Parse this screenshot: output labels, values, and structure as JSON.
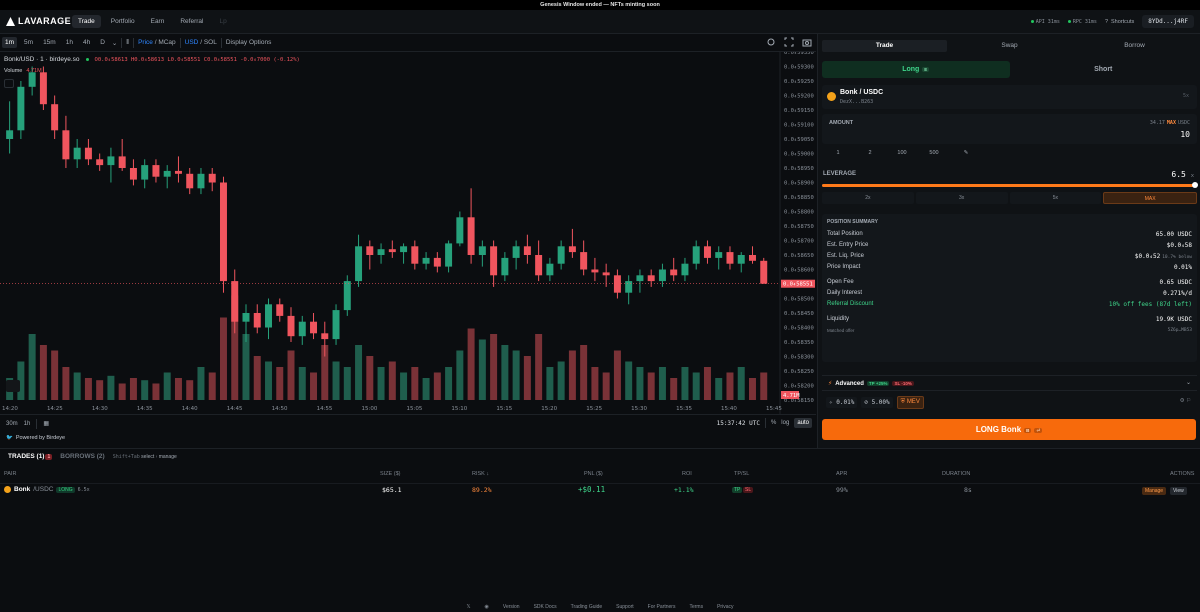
{
  "banner": "Genesis Window ended — NFTs minting soon",
  "brand": "LAVARAGE",
  "nav": [
    "Trade",
    "Portfolio",
    "Earn",
    "Referral",
    "Lp"
  ],
  "status": {
    "api": "API 31ms",
    "rpc": "RPC 31ms"
  },
  "shortcuts": "Shortcuts",
  "wallet": "8YDd...j4RF",
  "toolbar": {
    "timeframes": [
      "1m",
      "5m",
      "15m",
      "1h",
      "4h",
      "D"
    ],
    "price": "Price",
    "mcap": "MCap",
    "usd": "USD",
    "sol": "SOL",
    "display_options": "Display Options"
  },
  "legend": {
    "symbol": "Bonk/USD · 1 · birdeye.so",
    "ohlc": "O0.0₄58613 H0.0₄58613 L0.0₄58551 C0.0₄58551 -0.0₆7000 (-0.12%)",
    "volume_label": "Volume",
    "volume_value": "4.71M"
  },
  "chart_bottom": {
    "ranges": [
      "30m",
      "1h"
    ],
    "time": "15:37:42 UTC",
    "pct": "%",
    "log": "log",
    "auto": "auto"
  },
  "powered": "Powered by Birdeye",
  "chart_data": {
    "type": "candlestick",
    "x_ticks": [
      "14:20",
      "14:25",
      "14:30",
      "14:35",
      "14:40",
      "14:45",
      "14:50",
      "14:55",
      "15:00",
      "15:05",
      "15:10",
      "15:15",
      "15:20",
      "15:25",
      "15:30",
      "15:35",
      "15:40",
      "15:45"
    ],
    "y_ticks": [
      "0.0₄59350",
      "0.0₄59300",
      "0.0₄59250",
      "0.0₄59200",
      "0.0₄59150",
      "0.0₄59100",
      "0.0₄59050",
      "0.0₄59000",
      "0.0₄58950",
      "0.0₄58900",
      "0.0₄58850",
      "0.0₄58800",
      "0.0₄58750",
      "0.0₄58700",
      "0.0₄58650",
      "0.0₄58600",
      "0.0₄58550",
      "0.0₄58500",
      "0.0₄58450",
      "0.0₄58400",
      "0.0₄58350",
      "0.0₄58300",
      "0.0₄58250",
      "0.0₄58200",
      "0.0₄58150"
    ],
    "y_range": [
      58150,
      59350
    ],
    "last_price_label": "0.0₄58551",
    "last_price": 58551,
    "volume_label": "4.71M",
    "colors": {
      "up": "#26a17b",
      "down": "#f0555e",
      "vol_up": "#1f5e4d",
      "vol_down": "#7a3237"
    },
    "candles": [
      [
        59050,
        59180,
        59000,
        59080
      ],
      [
        59080,
        59250,
        59050,
        59230
      ],
      [
        59230,
        59300,
        59200,
        59280
      ],
      [
        59280,
        59300,
        59150,
        59170
      ],
      [
        59170,
        59200,
        59050,
        59080
      ],
      [
        59080,
        59130,
        58950,
        58980
      ],
      [
        58980,
        59050,
        58950,
        59020
      ],
      [
        59020,
        59050,
        58960,
        58980
      ],
      [
        58980,
        59000,
        58940,
        58960
      ],
      [
        58960,
        59020,
        58900,
        58990
      ],
      [
        58990,
        59050,
        58940,
        58950
      ],
      [
        58950,
        58980,
        58890,
        58910
      ],
      [
        58910,
        58980,
        58880,
        58960
      ],
      [
        58960,
        58980,
        58900,
        58920
      ],
      [
        58920,
        58960,
        58880,
        58940
      ],
      [
        58940,
        58990,
        58900,
        58930
      ],
      [
        58930,
        58950,
        58860,
        58880
      ],
      [
        58880,
        58950,
        58860,
        58930
      ],
      [
        58930,
        58950,
        58870,
        58900
      ],
      [
        58900,
        58920,
        58520,
        58560
      ],
      [
        58560,
        58600,
        58380,
        58420
      ],
      [
        58420,
        58480,
        58350,
        58450
      ],
      [
        58450,
        58480,
        58380,
        58400
      ],
      [
        58400,
        58500,
        58360,
        58480
      ],
      [
        58480,
        58500,
        58420,
        58440
      ],
      [
        58440,
        58470,
        58350,
        58370
      ],
      [
        58370,
        58440,
        58340,
        58420
      ],
      [
        58420,
        58450,
        58360,
        58380
      ],
      [
        58380,
        58420,
        58300,
        58360
      ],
      [
        58360,
        58480,
        58340,
        58460
      ],
      [
        58460,
        58580,
        58440,
        58560
      ],
      [
        58560,
        58720,
        58540,
        58680
      ],
      [
        58680,
        58700,
        58600,
        58650
      ],
      [
        58650,
        58690,
        58620,
        58670
      ],
      [
        58670,
        58700,
        58640,
        58660
      ],
      [
        58660,
        58690,
        58620,
        58680
      ],
      [
        58680,
        58700,
        58600,
        58620
      ],
      [
        58620,
        58660,
        58600,
        58640
      ],
      [
        58640,
        58660,
        58590,
        58610
      ],
      [
        58610,
        58700,
        58590,
        58690
      ],
      [
        58690,
        58800,
        58680,
        58780
      ],
      [
        58780,
        58880,
        58620,
        58650
      ],
      [
        58650,
        58700,
        58610,
        58680
      ],
      [
        58680,
        58700,
        58540,
        58580
      ],
      [
        58580,
        58660,
        58560,
        58640
      ],
      [
        58640,
        58700,
        58600,
        58680
      ],
      [
        58680,
        58720,
        58620,
        58650
      ],
      [
        58650,
        58700,
        58560,
        58580
      ],
      [
        58580,
        58640,
        58560,
        58620
      ],
      [
        58620,
        58700,
        58600,
        58680
      ],
      [
        58680,
        58740,
        58640,
        58660
      ],
      [
        58660,
        58700,
        58580,
        58600
      ],
      [
        58600,
        58640,
        58560,
        58590
      ],
      [
        58590,
        58620,
        58540,
        58580
      ],
      [
        58580,
        58600,
        58500,
        58520
      ],
      [
        58520,
        58580,
        58480,
        58560
      ],
      [
        58560,
        58600,
        58520,
        58580
      ],
      [
        58580,
        58600,
        58540,
        58560
      ],
      [
        58560,
        58620,
        58540,
        58600
      ],
      [
        58600,
        58640,
        58560,
        58580
      ],
      [
        58580,
        58640,
        58560,
        58620
      ],
      [
        58620,
        58700,
        58600,
        58680
      ],
      [
        58680,
        58700,
        58620,
        58640
      ],
      [
        58640,
        58680,
        58600,
        58660
      ],
      [
        58660,
        58680,
        58600,
        58620
      ],
      [
        58620,
        58660,
        58590,
        58650
      ],
      [
        58650,
        58680,
        58620,
        58630
      ],
      [
        58630,
        58640,
        58551,
        58551
      ]
    ],
    "volumes": [
      0.2,
      0.35,
      0.6,
      0.5,
      0.45,
      0.3,
      0.25,
      0.2,
      0.18,
      0.22,
      0.15,
      0.2,
      0.18,
      0.15,
      0.25,
      0.2,
      0.18,
      0.3,
      0.25,
      0.75,
      0.95,
      0.6,
      0.4,
      0.35,
      0.3,
      0.45,
      0.3,
      0.25,
      0.5,
      0.35,
      0.3,
      0.5,
      0.4,
      0.3,
      0.35,
      0.25,
      0.3,
      0.2,
      0.25,
      0.3,
      0.45,
      0.65,
      0.55,
      0.6,
      0.5,
      0.45,
      0.4,
      0.6,
      0.3,
      0.35,
      0.45,
      0.5,
      0.3,
      0.25,
      0.45,
      0.35,
      0.3,
      0.25,
      0.3,
      0.2,
      0.3,
      0.25,
      0.3,
      0.2,
      0.25,
      0.3,
      0.2,
      0.25
    ]
  },
  "panel": {
    "tabs": [
      "Trade",
      "Swap",
      "Borrow"
    ],
    "long": "Long",
    "long_key": "E",
    "short": "Short",
    "market_name": "Bonk / USDC",
    "market_addr": "DezX...B263",
    "market_x": "5x",
    "amount_label": "AMOUNT",
    "balance": "34.17",
    "max": "MAX",
    "balance_unit": "USDC",
    "amount_value": "10",
    "presets": [
      "1",
      "2",
      "100",
      "500"
    ],
    "leverage_label": "LEVERAGE",
    "leverage_value": "6.5",
    "leverage_unit": "x",
    "leverage_fraction": 1.0,
    "leverage_presets": [
      "2x",
      "3x",
      "5x",
      "MAX"
    ],
    "summary_title": "POSITION SUMMARY",
    "summary": [
      {
        "k": "Total Position",
        "v": "65.00 USDC"
      },
      {
        "k": "Est. Entry Price",
        "v": "$0.0₄58"
      },
      {
        "k": "Est. Liq. Price",
        "v": "$0.0₄52",
        "note": "10.7% below"
      },
      {
        "k": "Price Impact",
        "v": "0.01%"
      },
      {
        "k": "Open Fee",
        "v": "0.65 USDC"
      },
      {
        "k": "Daily Interest",
        "v": "0.271%/d"
      },
      {
        "k": "Referral Discount",
        "v": "10% off fees (87d left)"
      },
      {
        "k": "Liquidity",
        "v": "19.9K USDC"
      },
      {
        "k": "Matched offer",
        "v": "5Z6p…MB53"
      }
    ],
    "advanced": "Advanced",
    "adv_tp": "TP +25%",
    "adv_sl": "SL -10%",
    "slippage": "0.01%",
    "tip": "5.00%",
    "mev": "MEV",
    "long_button": "LONG Bonk",
    "long_button_key": "B"
  },
  "trades": {
    "tab1": "TRADES (1)",
    "tab1_badge": "1",
    "tab2": "BORROWS (2)",
    "hint_keys": "Shift+Tab",
    "hint_select": "select",
    "hint_manage": "manage",
    "columns": [
      "PAIR",
      "SIZE ($)",
      "RISK ↓",
      "PNL ($)",
      "ROI",
      "TP/SL",
      "APR",
      "DURATION",
      "ACTIONS"
    ],
    "row": {
      "pair": "Bonk",
      "quote": "/USDC",
      "side": "LONG",
      "lev": "6.5x",
      "size": "$65.1",
      "risk": "89.2%",
      "pnl": "+$0.11",
      "roi": "+1.1%",
      "tp": "TP",
      "sl": "SL",
      "apr": "99%",
      "duration": "8s",
      "manage": "Manage",
      "view": "View"
    }
  },
  "footer": [
    "Version",
    "SDK Docs",
    "Trading Guide",
    "Support",
    "For Partners",
    "Terms",
    "Privacy"
  ]
}
